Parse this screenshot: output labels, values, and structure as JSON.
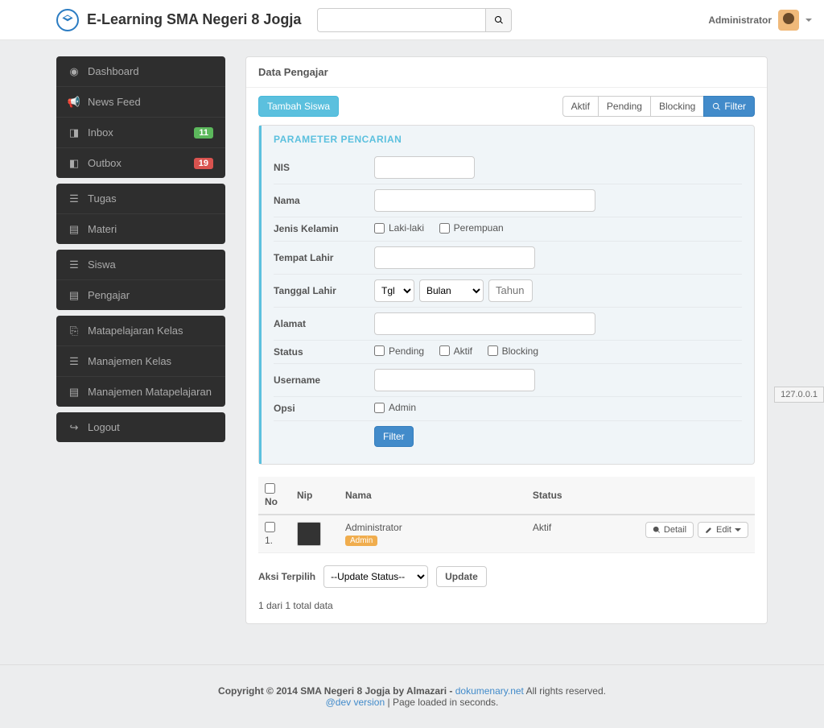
{
  "header": {
    "brand": "E-Learning SMA Negeri 8 Jogja",
    "user": "Administrator"
  },
  "sidebar": {
    "g1": [
      {
        "label": "Dashboard"
      },
      {
        "label": "News Feed"
      },
      {
        "label": "Inbox",
        "badge": "11",
        "color": "green"
      },
      {
        "label": "Outbox",
        "badge": "19",
        "color": "red"
      }
    ],
    "g2": [
      {
        "label": "Tugas"
      },
      {
        "label": "Materi"
      }
    ],
    "g3": [
      {
        "label": "Siswa"
      },
      {
        "label": "Pengajar"
      }
    ],
    "g4": [
      {
        "label": "Matapelajaran Kelas"
      },
      {
        "label": "Manajemen Kelas"
      },
      {
        "label": "Manajemen Matapelajaran"
      }
    ],
    "g5": [
      {
        "label": "Logout"
      }
    ]
  },
  "panel": {
    "title": "Data Pengajar",
    "add": "Tambah Siswa",
    "tabs": {
      "aktif": "Aktif",
      "pending": "Pending",
      "blocking": "Blocking",
      "filter": "Filter"
    }
  },
  "filter": {
    "heading": "PARAMETER PENCARIAN",
    "labels": {
      "nis": "NIS",
      "nama": "Nama",
      "jk": "Jenis Kelamin",
      "tpt": "Tempat Lahir",
      "tgl": "Tanggal Lahir",
      "alamat": "Alamat",
      "status": "Status",
      "username": "Username",
      "opsi": "Opsi"
    },
    "jk": {
      "l": "Laki-laki",
      "p": "Perempuan"
    },
    "date": {
      "tgl": "Tgl",
      "bulan": "Bulan",
      "tahun": "Tahun"
    },
    "status": {
      "pending": "Pending",
      "aktif": "Aktif",
      "blocking": "Blocking"
    },
    "opsi_admin": "Admin",
    "submit": "Filter"
  },
  "table": {
    "headers": {
      "no": "No",
      "nip": "Nip",
      "nama": "Nama",
      "status": "Status"
    },
    "rows": [
      {
        "no": "1.",
        "nama": "Administrator",
        "tag": "Admin",
        "status": "Aktif"
      }
    ],
    "actions": {
      "detail": "Detail",
      "edit": "Edit"
    }
  },
  "bulk": {
    "label": "Aksi Terpilih",
    "select": "--Update Status--",
    "update": "Update"
  },
  "pagination": "1 dari 1 total data",
  "footer": {
    "copyright": "Copyright © 2014 SMA Negeri 8 Jogja by Almazari - ",
    "link": "dokumenary.net",
    "rights": " All rights reserved.",
    "dev": "@dev version",
    "loaded": " | Page loaded in seconds."
  },
  "ip": "127.0.0.1"
}
